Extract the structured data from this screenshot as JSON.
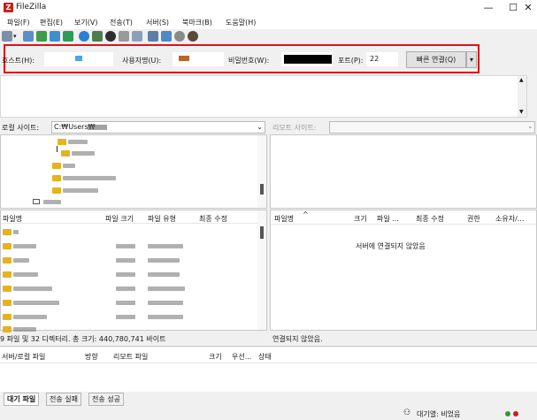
{
  "window": {
    "title": "FileZilla",
    "minimize": "—",
    "maximize": "☐",
    "close": "✕"
  },
  "menu": [
    "파일(F)",
    "편집(E)",
    "보기(V)",
    "전송(T)",
    "서버(S)",
    "북마크(B)",
    "도움말(H)"
  ],
  "quickconnect": {
    "host_label": "호스트(H):",
    "host_value": "",
    "user_label": "사용자명(U):",
    "user_value": "",
    "pass_label": "비밀번호(W):",
    "pass_value": "",
    "port_label": "포트(P):",
    "port_value": "22",
    "connect_label": "빠른 연결(Q)",
    "dropdown": "▾"
  },
  "local": {
    "site_label": "로컬 사이트:",
    "site_path": "C:₩Users₩",
    "columns": [
      "파일명",
      "파일 크기",
      "파일 유형",
      "최종 수정"
    ],
    "status": "9 파일 및 32 디렉터리. 총 크기: 440,780,741 바이트"
  },
  "remote": {
    "site_label": "리모트 사이트:",
    "site_path": "",
    "columns": [
      "파일명",
      "크기",
      "파일 ...",
      "최종 수정",
      "권한",
      "소유자/..."
    ],
    "not_connected": "서버에 연결되지 않았음",
    "status": "연결되지 않았음."
  },
  "queue": {
    "columns": [
      "서버/로컬 파일",
      "방향",
      "리모트 파일",
      "크기",
      "우선...",
      "상태"
    ]
  },
  "tabs": [
    "대기 파일",
    "전송 실패",
    "전송 성공"
  ],
  "statusbar": {
    "queue_text": "대기열: 비었음"
  },
  "colors": {
    "highlight_border": "#e0101a",
    "folder": "#e6b21e",
    "accent_blue": "#2f86d8"
  }
}
